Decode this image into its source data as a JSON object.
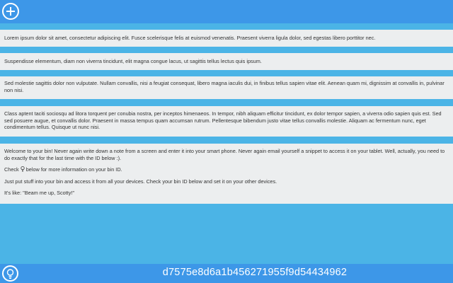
{
  "toolbar": {
    "add_icon": "plus-circle-icon"
  },
  "notes": [
    {
      "text": "Lorem ipsum dolor sit amet, consectetur adipiscing elit. Fusce scelerisque felis at euismod venenatis. Praesent viverra ligula dolor, sed egestas libero porttitor nec."
    },
    {
      "text": "Suspendisse elementum, diam non viverra tincidunt, elit magna congue lacus, ut sagittis tellus lectus quis ipsum."
    },
    {
      "text": "Sed molestie sagittis dolor non vulputate. Nullam convallis, nisi a feugiat consequat, libero magna iaculis dui, in finibus tellus sapien vitae elit. Aenean quam mi, dignissim at convallis in, pulvinar non nisi."
    },
    {
      "text": "Class aptent taciti sociosqu ad litora torquent per conubia nostra, per inceptos himenaeos. In tempor, nibh aliquam efficitur tincidunt, ex dolor tempor sapien, a viverra odio sapien quis est. Sed sed posuere augue, et convallis dolor. Praesent in massa tempus quam accumsan rutrum. Pellentesque bibendum justo vitae tellus convallis molestie. Aliquam ac fermentum nunc, eget condimentum tellus. Quisque ut nunc nisi."
    }
  ],
  "welcome": {
    "line1": "Welcome to your bin! Never again write down a note from a screen and enter it into your smart phone. Never again email yourself a snippet to access it on your tablet. Well, actually, you need to",
    "line2": "do exactly that for the last time with the ID below :).",
    "check_prefix": "Check",
    "check_suffix": "below for more information on your bin ID.",
    "paragraph3": "Just put stuff into your bin and access it from all your devices. Check your bin ID below and set it on your other devices.",
    "paragraph4": "It's like: \"Beam me up, Scotty!\""
  },
  "footer": {
    "info_icon": "lightbulb-icon",
    "bin_id": "d7575e8d6a1b456271955f9d54434962"
  },
  "colors": {
    "bars": "#3d97e8",
    "background": "#4bb4e6",
    "note_background": "#eceeef"
  }
}
